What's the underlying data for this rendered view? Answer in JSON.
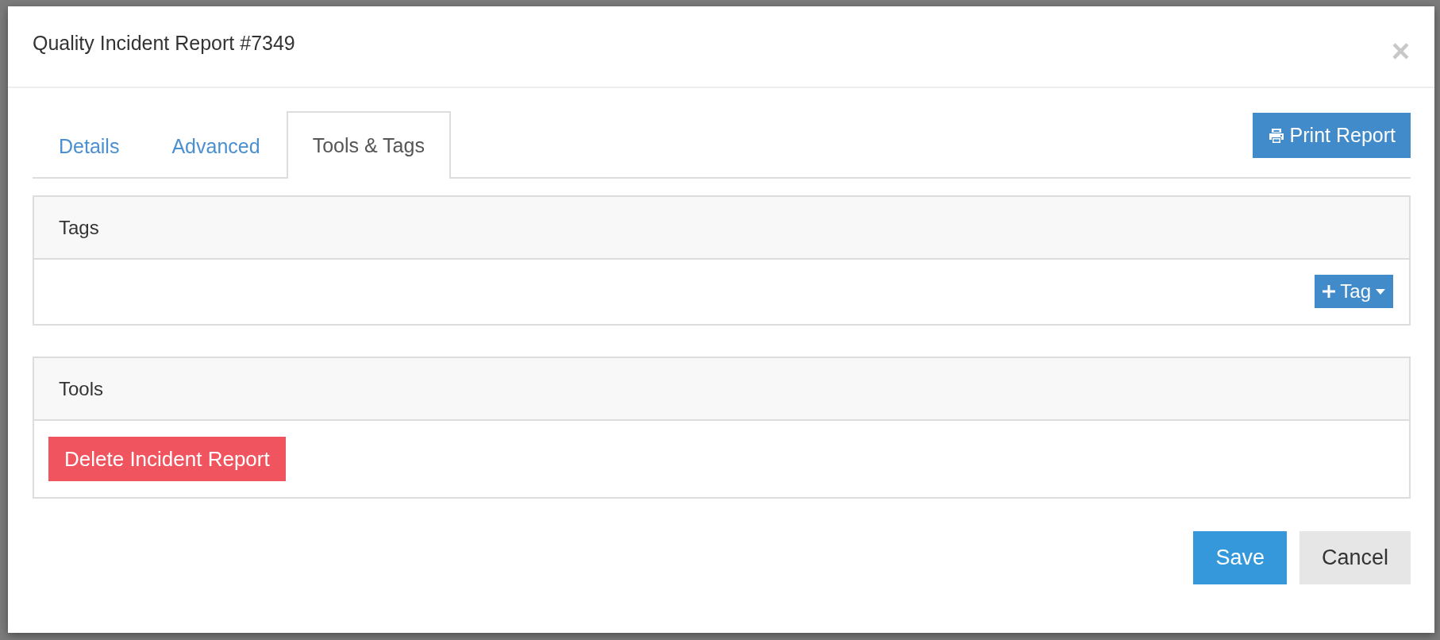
{
  "dialog": {
    "title": "Quality Incident Report #7349",
    "close": "×",
    "tabs": [
      {
        "label": "Details",
        "selected": false
      },
      {
        "label": "Advanced",
        "selected": false
      },
      {
        "label": "Tools & Tags",
        "selected": true
      }
    ],
    "print_button": "Print Report",
    "panels": [
      {
        "heading": "Tags",
        "kind": "tags",
        "button": "Tag"
      },
      {
        "heading": "Tools",
        "kind": "tools",
        "button": "Delete Incident Report"
      }
    ],
    "footer": {
      "save": "Save",
      "cancel": "Cancel"
    }
  }
}
